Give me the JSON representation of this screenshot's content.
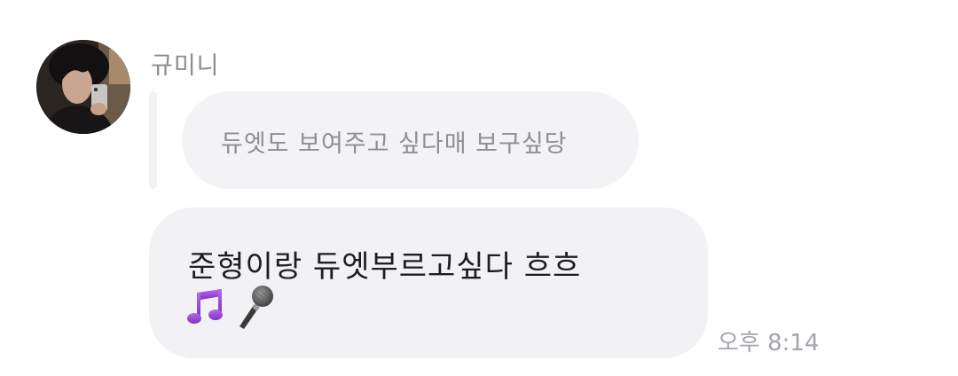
{
  "sender": {
    "name": "규미니",
    "avatar_icon": "profile-photo-avatar"
  },
  "quote": {
    "text": "듀엣도 보여주고 싶다매 보구싶당"
  },
  "message": {
    "line1": "준형이랑 듀엣부르고싶다 흐흐",
    "emojis": [
      "music-notes-icon",
      "microphone-icon"
    ],
    "timestamp": "오후 8:14"
  },
  "colors": {
    "bubble": "#f2f2f5",
    "quote_text": "#8e8e95",
    "message_text": "#1e1e22",
    "timestamp": "#a4a4ab",
    "music_notes": "#9b4fd6"
  }
}
